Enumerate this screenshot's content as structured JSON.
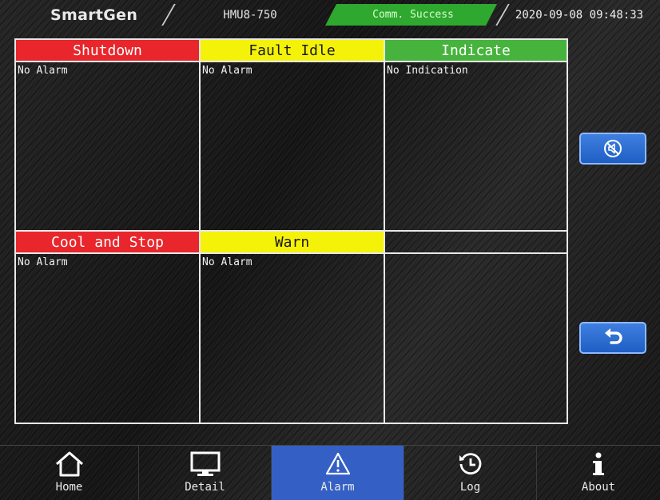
{
  "header": {
    "logo": "SmartGen",
    "model": "HMU8-750",
    "comm_status": "Comm. Success",
    "datetime": "2020-09-08 09:48:33"
  },
  "alarm_panels": [
    {
      "title": "Shutdown",
      "color": "#e8262b",
      "message": "No Alarm"
    },
    {
      "title": "Fault Idle",
      "color": "#f5f20a",
      "message": "No Alarm"
    },
    {
      "title": "Indicate",
      "color": "#46b43c",
      "message": "No Indication"
    },
    {
      "title": "Cool and Stop",
      "color": "#e8262b",
      "message": "No Alarm"
    },
    {
      "title": "Warn",
      "color": "#f5f20a",
      "message": "No Alarm"
    },
    {
      "title": "",
      "color": "",
      "message": ""
    }
  ],
  "side_buttons": [
    {
      "icon": "mute-alarm-icon"
    },
    {
      "icon": "back-arrow-icon"
    }
  ],
  "nav": [
    {
      "label": "Home",
      "icon": "home-icon",
      "active": false
    },
    {
      "label": "Detail",
      "icon": "monitor-icon",
      "active": false
    },
    {
      "label": "Alarm",
      "icon": "warning-icon",
      "active": true
    },
    {
      "label": "Log",
      "icon": "history-icon",
      "active": false
    },
    {
      "label": "About",
      "icon": "info-icon",
      "active": false
    }
  ],
  "colors": {
    "comm_ok": "#2ea82e",
    "nav_active": "#3460c6",
    "button_blue": "#2f6fd6"
  }
}
